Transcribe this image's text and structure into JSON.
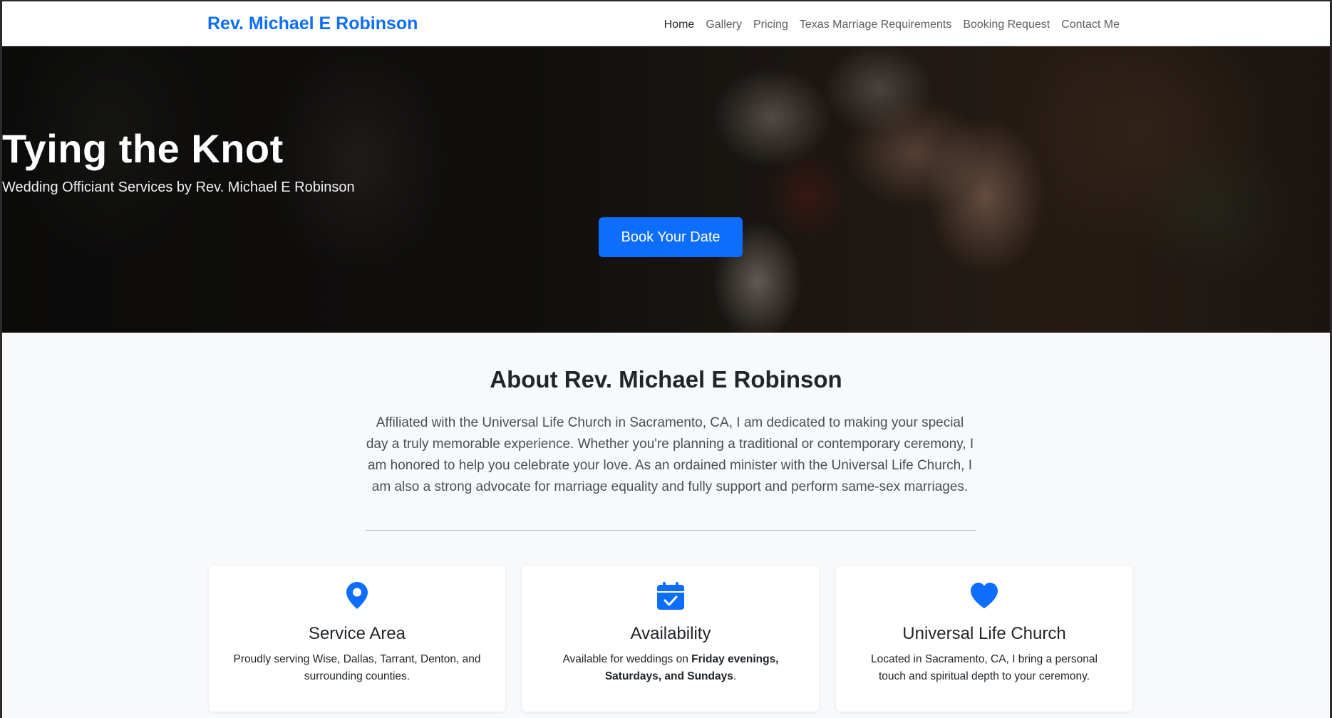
{
  "brand": "Rev. Michael E Robinson",
  "nav": {
    "items": [
      {
        "label": "Home",
        "active": true
      },
      {
        "label": "Gallery"
      },
      {
        "label": "Pricing"
      },
      {
        "label": "Texas Marriage Requirements"
      },
      {
        "label": "Booking Request"
      },
      {
        "label": "Contact Me"
      }
    ]
  },
  "hero": {
    "title": "Tying the Knot",
    "subtitle": "Wedding Officiant Services by Rev. Michael E Robinson",
    "button_label": "Book Your Date"
  },
  "about": {
    "heading": "About Rev. Michael E Robinson",
    "text": "Affiliated with the Universal Life Church in Sacramento, CA, I am dedicated to making your special day a truly memorable experience. Whether you're planning a traditional or contemporary ceremony, I am honored to help you celebrate your love. As an ordained minister with the Universal Life Church, I am also a strong advocate for marriage equality and fully support and perform same-sex marriages."
  },
  "cards": [
    {
      "icon": "map-pin-icon",
      "title": "Service Area",
      "text": "Proudly serving Wise, Dallas, Tarrant, Denton, and surrounding counties."
    },
    {
      "icon": "calendar-check-icon",
      "title": "Availability",
      "text_before": "Available for weddings on ",
      "text_bold": "Friday evenings, Saturdays, and Sundays",
      "text_after": "."
    },
    {
      "icon": "heart-icon",
      "title": "Universal Life Church",
      "text": "Located in Sacramento, CA, I bring a personal touch and spiritual depth to your ceremony."
    }
  ],
  "colors": {
    "accent": "#0d6efd",
    "page_bg": "#f8f9fa",
    "text": "#212529"
  }
}
